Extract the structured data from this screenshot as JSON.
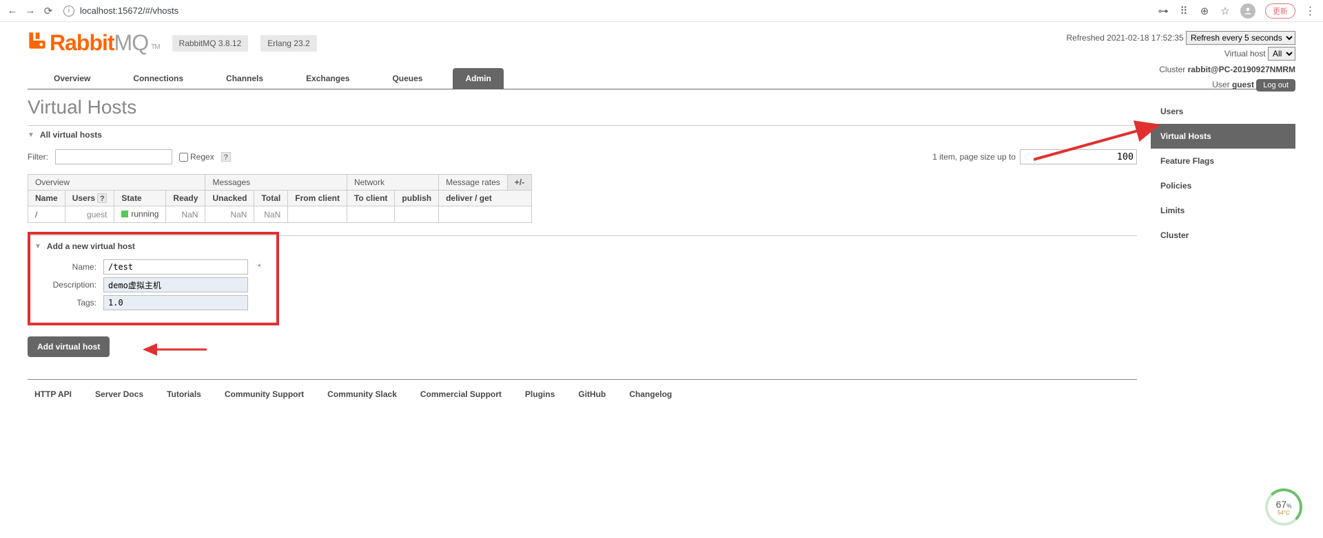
{
  "browser": {
    "url": "localhost:15672/#/vhosts",
    "update_label": "更新"
  },
  "logo": {
    "rabbit": "Rabbit",
    "mq": "MQ",
    "tm": "TM"
  },
  "versions": {
    "rabbit": "RabbitMQ 3.8.12",
    "erlang": "Erlang 23.2"
  },
  "status": {
    "refreshed_prefix": "Refreshed ",
    "refreshed_time": "2021-02-18 17:52:35",
    "refresh_options": [
      "Refresh every 5 seconds"
    ],
    "refresh_selected": "Refresh every 5 seconds",
    "vhost_label": "Virtual host",
    "vhost_options": [
      "All"
    ],
    "vhost_selected": "All",
    "cluster_label": "Cluster ",
    "cluster_value": "rabbit@PC-20190927NMRM",
    "user_label": "User ",
    "user_value": "guest",
    "logout": "Log out"
  },
  "tabs": [
    "Overview",
    "Connections",
    "Channels",
    "Exchanges",
    "Queues",
    "Admin"
  ],
  "active_tab": "Admin",
  "page_title": "Virtual Hosts",
  "section_all": "All virtual hosts",
  "filter": {
    "label": "Filter:",
    "value": "",
    "regex_label": "Regex",
    "items_text": "1 item, page size up to",
    "page_size": "100"
  },
  "table": {
    "group_headers": [
      "Overview",
      "Messages",
      "Network",
      "Message rates",
      "+/-"
    ],
    "sub_headers": [
      "Name",
      "Users",
      "?",
      "State",
      "Ready",
      "Unacked",
      "Total",
      "From client",
      "To client",
      "publish",
      "deliver / get"
    ],
    "row": {
      "name": "/",
      "users": "guest",
      "state": "running",
      "ready": "NaN",
      "unacked": "NaN",
      "total": "NaN",
      "from_client": "",
      "to_client": "",
      "publish": "",
      "deliver": ""
    }
  },
  "add_section": "Add a new virtual host",
  "form": {
    "name_label": "Name:",
    "name_value": "/test",
    "desc_label": "Description:",
    "desc_value": "demo虚拟主机",
    "tags_label": "Tags:",
    "tags_value": "1.0",
    "submit": "Add virtual host"
  },
  "side_nav": [
    "Users",
    "Virtual Hosts",
    "Feature Flags",
    "Policies",
    "Limits",
    "Cluster"
  ],
  "side_active": "Virtual Hosts",
  "footer_links": [
    "HTTP API",
    "Server Docs",
    "Tutorials",
    "Community Support",
    "Community Slack",
    "Commercial Support",
    "Plugins",
    "GitHub",
    "Changelog"
  ],
  "gauge": {
    "value": "67",
    "unit": "%",
    "temp": "54°C"
  }
}
